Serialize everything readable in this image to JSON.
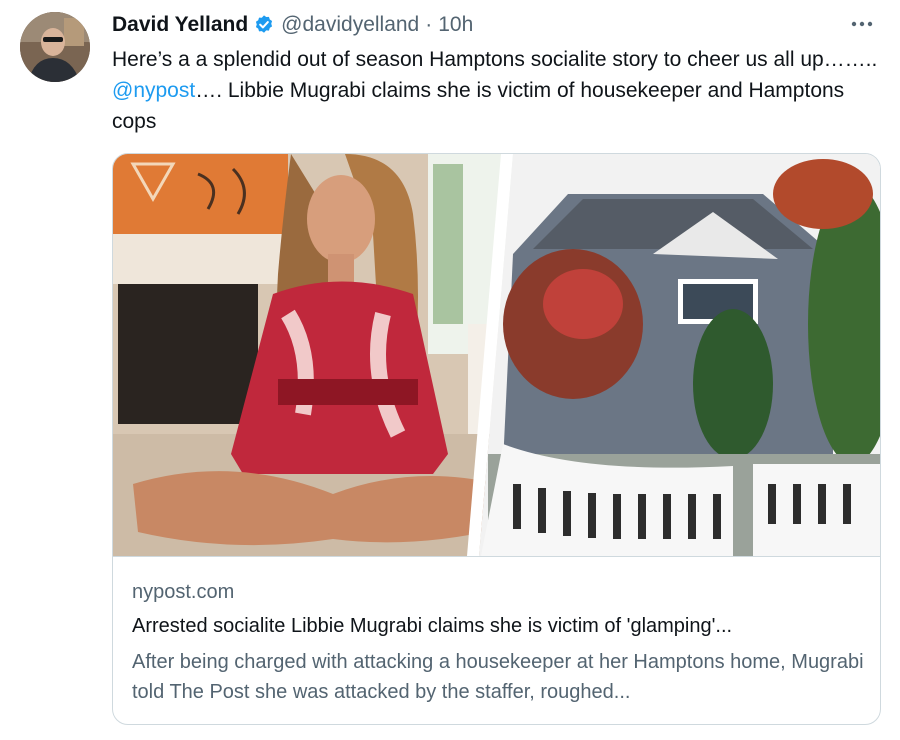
{
  "author": {
    "name": "David Yelland",
    "handle": "@davidyelland",
    "separator": "·",
    "time": "10h",
    "verified": true
  },
  "more_icon": "more-horizontal-icon",
  "tweet": {
    "text_before": "Here’s a a splendid out of season Hamptons socialite story to cheer us all up…….. ",
    "mention": "@nypost",
    "text_after": "…. Libbie Mugrabi claims she is victim of housekeeper and Hamptons cops"
  },
  "card": {
    "domain": "nypost.com",
    "title": "Arrested socialite Libbie Mugrabi claims she is victim of 'glamping'...",
    "description": "After being charged with attacking a housekeeper at her Hamptons home, Mugrabi told The Post she was attacked by the staffer, roughed..."
  },
  "colors": {
    "link": "#1d9bf0",
    "verified": "#1d9bf0",
    "secondary_text": "#536471",
    "border": "#cfd9de"
  }
}
